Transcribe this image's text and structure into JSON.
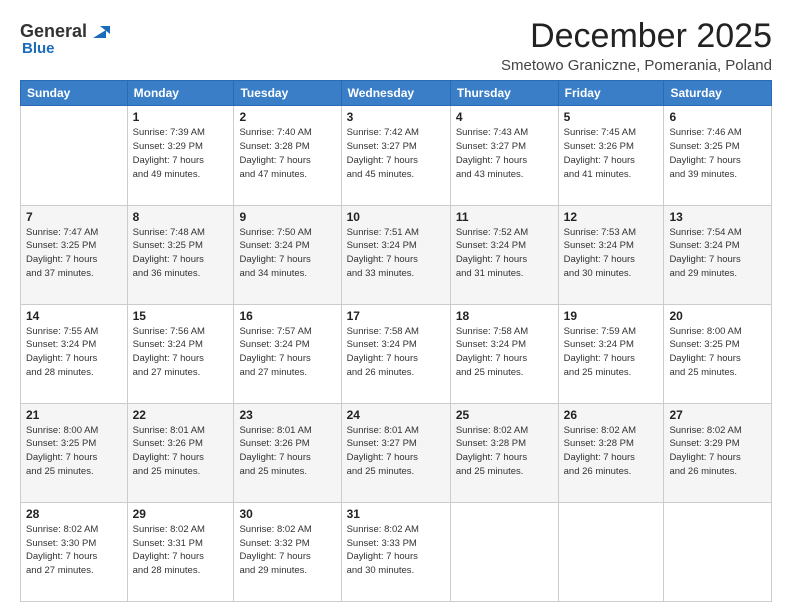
{
  "logo": {
    "general": "General",
    "blue": "Blue",
    "icon_color": "#1a6bbb"
  },
  "title": "December 2025",
  "subtitle": "Smetowo Graniczne, Pomerania, Poland",
  "days_of_week": [
    "Sunday",
    "Monday",
    "Tuesday",
    "Wednesday",
    "Thursday",
    "Friday",
    "Saturday"
  ],
  "weeks": [
    [
      {
        "day": "",
        "info": ""
      },
      {
        "day": "1",
        "info": "Sunrise: 7:39 AM\nSunset: 3:29 PM\nDaylight: 7 hours\nand 49 minutes."
      },
      {
        "day": "2",
        "info": "Sunrise: 7:40 AM\nSunset: 3:28 PM\nDaylight: 7 hours\nand 47 minutes."
      },
      {
        "day": "3",
        "info": "Sunrise: 7:42 AM\nSunset: 3:27 PM\nDaylight: 7 hours\nand 45 minutes."
      },
      {
        "day": "4",
        "info": "Sunrise: 7:43 AM\nSunset: 3:27 PM\nDaylight: 7 hours\nand 43 minutes."
      },
      {
        "day": "5",
        "info": "Sunrise: 7:45 AM\nSunset: 3:26 PM\nDaylight: 7 hours\nand 41 minutes."
      },
      {
        "day": "6",
        "info": "Sunrise: 7:46 AM\nSunset: 3:25 PM\nDaylight: 7 hours\nand 39 minutes."
      }
    ],
    [
      {
        "day": "7",
        "info": "Sunrise: 7:47 AM\nSunset: 3:25 PM\nDaylight: 7 hours\nand 37 minutes."
      },
      {
        "day": "8",
        "info": "Sunrise: 7:48 AM\nSunset: 3:25 PM\nDaylight: 7 hours\nand 36 minutes."
      },
      {
        "day": "9",
        "info": "Sunrise: 7:50 AM\nSunset: 3:24 PM\nDaylight: 7 hours\nand 34 minutes."
      },
      {
        "day": "10",
        "info": "Sunrise: 7:51 AM\nSunset: 3:24 PM\nDaylight: 7 hours\nand 33 minutes."
      },
      {
        "day": "11",
        "info": "Sunrise: 7:52 AM\nSunset: 3:24 PM\nDaylight: 7 hours\nand 31 minutes."
      },
      {
        "day": "12",
        "info": "Sunrise: 7:53 AM\nSunset: 3:24 PM\nDaylight: 7 hours\nand 30 minutes."
      },
      {
        "day": "13",
        "info": "Sunrise: 7:54 AM\nSunset: 3:24 PM\nDaylight: 7 hours\nand 29 minutes."
      }
    ],
    [
      {
        "day": "14",
        "info": "Sunrise: 7:55 AM\nSunset: 3:24 PM\nDaylight: 7 hours\nand 28 minutes."
      },
      {
        "day": "15",
        "info": "Sunrise: 7:56 AM\nSunset: 3:24 PM\nDaylight: 7 hours\nand 27 minutes."
      },
      {
        "day": "16",
        "info": "Sunrise: 7:57 AM\nSunset: 3:24 PM\nDaylight: 7 hours\nand 27 minutes."
      },
      {
        "day": "17",
        "info": "Sunrise: 7:58 AM\nSunset: 3:24 PM\nDaylight: 7 hours\nand 26 minutes."
      },
      {
        "day": "18",
        "info": "Sunrise: 7:58 AM\nSunset: 3:24 PM\nDaylight: 7 hours\nand 25 minutes."
      },
      {
        "day": "19",
        "info": "Sunrise: 7:59 AM\nSunset: 3:24 PM\nDaylight: 7 hours\nand 25 minutes."
      },
      {
        "day": "20",
        "info": "Sunrise: 8:00 AM\nSunset: 3:25 PM\nDaylight: 7 hours\nand 25 minutes."
      }
    ],
    [
      {
        "day": "21",
        "info": "Sunrise: 8:00 AM\nSunset: 3:25 PM\nDaylight: 7 hours\nand 25 minutes."
      },
      {
        "day": "22",
        "info": "Sunrise: 8:01 AM\nSunset: 3:26 PM\nDaylight: 7 hours\nand 25 minutes."
      },
      {
        "day": "23",
        "info": "Sunrise: 8:01 AM\nSunset: 3:26 PM\nDaylight: 7 hours\nand 25 minutes."
      },
      {
        "day": "24",
        "info": "Sunrise: 8:01 AM\nSunset: 3:27 PM\nDaylight: 7 hours\nand 25 minutes."
      },
      {
        "day": "25",
        "info": "Sunrise: 8:02 AM\nSunset: 3:28 PM\nDaylight: 7 hours\nand 25 minutes."
      },
      {
        "day": "26",
        "info": "Sunrise: 8:02 AM\nSunset: 3:28 PM\nDaylight: 7 hours\nand 26 minutes."
      },
      {
        "day": "27",
        "info": "Sunrise: 8:02 AM\nSunset: 3:29 PM\nDaylight: 7 hours\nand 26 minutes."
      }
    ],
    [
      {
        "day": "28",
        "info": "Sunrise: 8:02 AM\nSunset: 3:30 PM\nDaylight: 7 hours\nand 27 minutes."
      },
      {
        "day": "29",
        "info": "Sunrise: 8:02 AM\nSunset: 3:31 PM\nDaylight: 7 hours\nand 28 minutes."
      },
      {
        "day": "30",
        "info": "Sunrise: 8:02 AM\nSunset: 3:32 PM\nDaylight: 7 hours\nand 29 minutes."
      },
      {
        "day": "31",
        "info": "Sunrise: 8:02 AM\nSunset: 3:33 PM\nDaylight: 7 hours\nand 30 minutes."
      },
      {
        "day": "",
        "info": ""
      },
      {
        "day": "",
        "info": ""
      },
      {
        "day": "",
        "info": ""
      }
    ]
  ]
}
